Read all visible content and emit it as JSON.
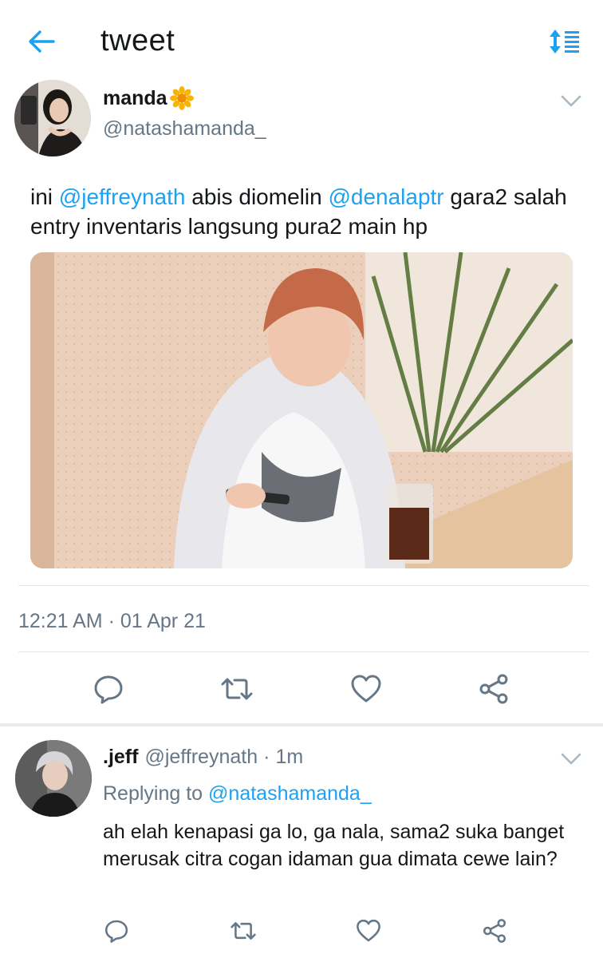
{
  "header": {
    "title": "tweet",
    "back_icon": "arrow-left-icon",
    "sort_icon": "sort-list-icon",
    "accent_color": "#1da1f2"
  },
  "tweet": {
    "author_name": "manda",
    "author_emoji": "🌼",
    "author_handle": "@natashamanda_",
    "text": {
      "part1": "ini ",
      "mention1": "@jeffreynath",
      "part2": " abis diomelin ",
      "mention2": "@denalaptr",
      "part3": " gara2 salah entry inventaris langsung pura2 main hp"
    },
    "timestamp": "12:21 AM · 01 Apr 21",
    "actions": [
      "reply-icon",
      "retweet-icon",
      "like-icon",
      "share-icon"
    ]
  },
  "reply": {
    "name": ".jeff",
    "handle": "@jeffreynath",
    "dot": "·",
    "time": "1m",
    "replying_prefix": "Replying to ",
    "replying_handle": "@natashamanda_",
    "text": "ah elah kenapasi ga lo, ga nala, sama2 suka banget merusak citra cogan idaman gua dimata cewe lain?",
    "actions": [
      "reply-icon",
      "retweet-icon",
      "like-icon",
      "share-icon"
    ]
  }
}
